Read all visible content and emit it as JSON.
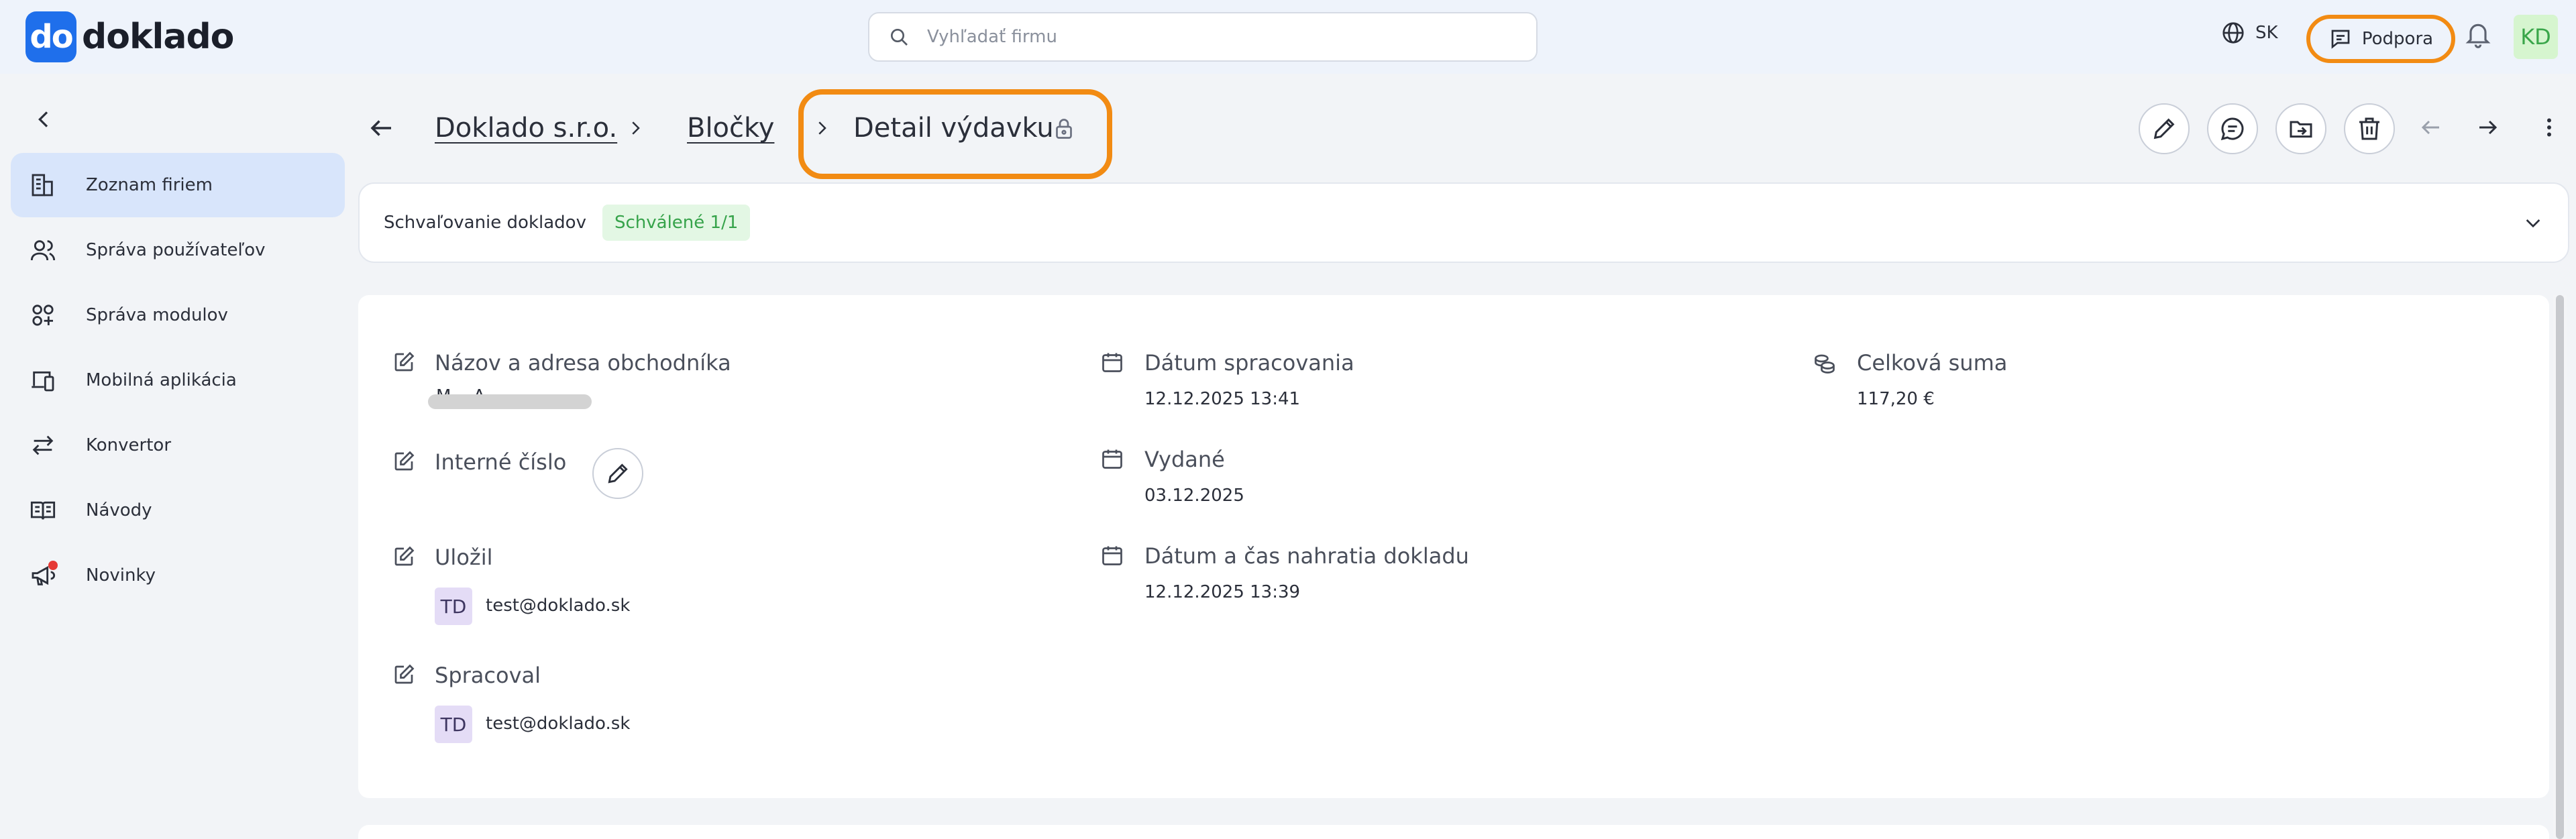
{
  "topbar": {
    "logo_mark": "do",
    "logo_text": "doklado",
    "search_placeholder": "Vyhľadať firmu",
    "language": "SK",
    "support_label": "Podpora",
    "user_initials": "KD"
  },
  "sidebar": {
    "items": [
      {
        "label": "Zoznam firiem",
        "icon": "buildings-icon",
        "active": true
      },
      {
        "label": "Správa používateľov",
        "icon": "users-icon",
        "active": false
      },
      {
        "label": "Správa modulov",
        "icon": "modules-icon",
        "active": false
      },
      {
        "label": "Mobilná aplikácia",
        "icon": "mobile-app-icon",
        "active": false
      },
      {
        "label": "Konvertor",
        "icon": "converter-icon",
        "active": false
      },
      {
        "label": "Návody",
        "icon": "book-icon",
        "active": false
      },
      {
        "label": "Novinky",
        "icon": "megaphone-icon",
        "active": false
      }
    ]
  },
  "breadcrumb": {
    "company": "Doklado s.r.o.",
    "section": "Bločky",
    "current": "Detail výdavku"
  },
  "approval": {
    "label": "Schvaľovanie dokladov",
    "status": "Schválené 1/1"
  },
  "details": {
    "merchant_label": "Názov a adresa obchodníka",
    "merchant_value": "M...   A...",
    "internal_number_label": "Interné číslo",
    "saved_by_label": "Uložil",
    "saved_by_initials": "TD",
    "saved_by_email": "test@doklado.sk",
    "processed_by_label": "Spracoval",
    "processed_by_initials": "TD",
    "processed_by_email": "test@doklado.sk",
    "processing_date_label": "Dátum spracovania",
    "processing_date_value": "12.12.2025 13:41",
    "issued_label": "Vydané",
    "issued_value": "03.12.2025",
    "upload_label": "Dátum a čas nahratia dokladu",
    "upload_value": "12.12.2025 13:39",
    "total_label": "Celková suma",
    "total_value": "117,20 €"
  },
  "colors": {
    "accent": "#1f6feb",
    "highlight": "#f28b13",
    "active_nav": "#d8e5fb",
    "success": "#36a34a"
  }
}
